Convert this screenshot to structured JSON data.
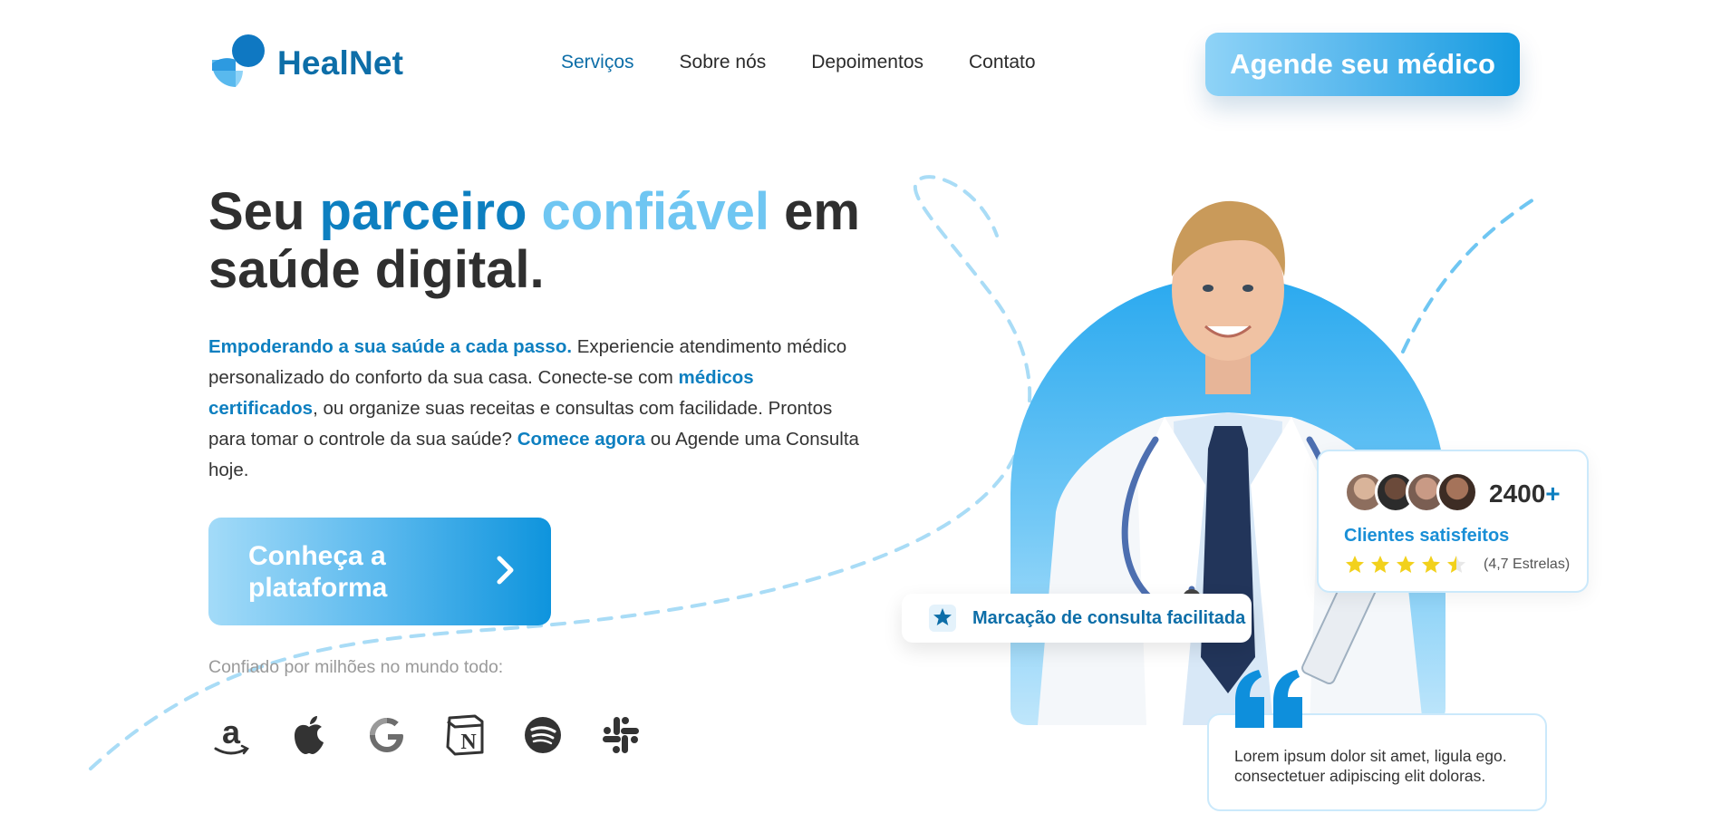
{
  "brand": {
    "name": "HealNet",
    "logo_icon": "healnet-logo-icon"
  },
  "nav": {
    "items": [
      {
        "label": "Serviços",
        "active": true
      },
      {
        "label": "Sobre nós",
        "active": false
      },
      {
        "label": "Depoimentos",
        "active": false
      },
      {
        "label": "Contato",
        "active": false
      }
    ],
    "cta_label": "Agende seu médico"
  },
  "hero": {
    "title_part1": "Seu ",
    "title_hl1": "parceiro",
    "title_hl2": "confiável",
    "title_part2": " em saúde digital.",
    "desc_strong1": "Empoderando a sua saúde a cada passo.",
    "desc_text1": " Experiencie atendimento médico personalizado do conforto da sua casa. Conecte-se com ",
    "desc_strong2": "médicos certificados",
    "desc_text2": ", ou organize suas receitas e consultas com facilidade. Prontos para tomar o controle da sua saúde? ",
    "desc_strong3": "Comece agora",
    "desc_text3": " ou Agende uma Consulta hoje.",
    "cta_label": "Conheça a plataforma",
    "cta_icon": "chevron-right-icon",
    "trust_label": "Confiado por milhões no mundo todo:"
  },
  "brands": [
    "amazon-icon",
    "apple-icon",
    "google-icon",
    "notion-icon",
    "spotify-icon",
    "slack-icon"
  ],
  "rating_card": {
    "count": "2400",
    "count_suffix": "+",
    "label": "Clientes satisfeitos",
    "rating_value": 4.7,
    "rating_label": "(4,7 Estrelas)"
  },
  "pill_card": {
    "icon": "star-icon",
    "label": "Marcação de consulta facilitada"
  },
  "quote_card": {
    "icon": "quote-icon",
    "text": "Lorem ipsum dolor sit amet, ligula ego. consectetuer adipiscing elit doloras."
  },
  "colors": {
    "brand_blue": "#0d6ea8",
    "accent_blue": "#1a8fd6",
    "light_blue": "#6fc6f2",
    "star_yellow": "#f2d11c"
  }
}
